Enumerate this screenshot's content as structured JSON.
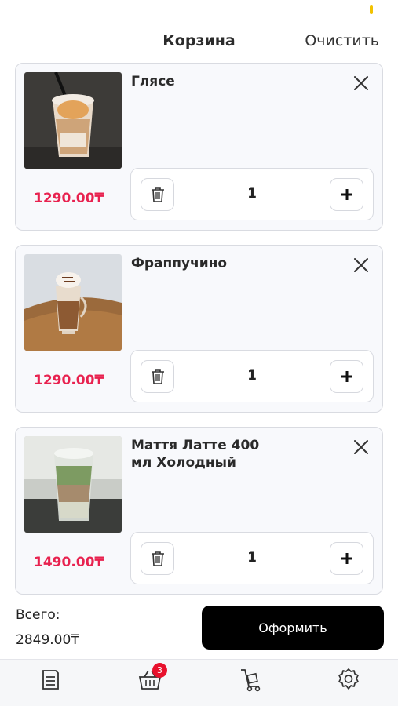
{
  "header": {
    "title": "Корзина",
    "clear_label": "Очистить"
  },
  "cart_items": [
    {
      "name": "Глясе",
      "price": "1290.00₸",
      "quantity": "1"
    },
    {
      "name": "Фраппучино",
      "price": "1290.00₸",
      "quantity": "1"
    },
    {
      "name": "Маття Латте 400 мл Холодный",
      "price": "1490.00₸",
      "quantity": "1"
    }
  ],
  "summary": {
    "total_label": "Всего:",
    "total_value": "2849.00₸",
    "checkout_label": "Оформить"
  },
  "tabbar": {
    "cart_badge": "3",
    "icons": [
      "menu-list-icon",
      "basket-icon",
      "delivery-cart-icon",
      "settings-gear-icon"
    ]
  },
  "colors": {
    "price": "#e8224f",
    "badge": "#e8112d",
    "checkout_bg": "#000000"
  }
}
